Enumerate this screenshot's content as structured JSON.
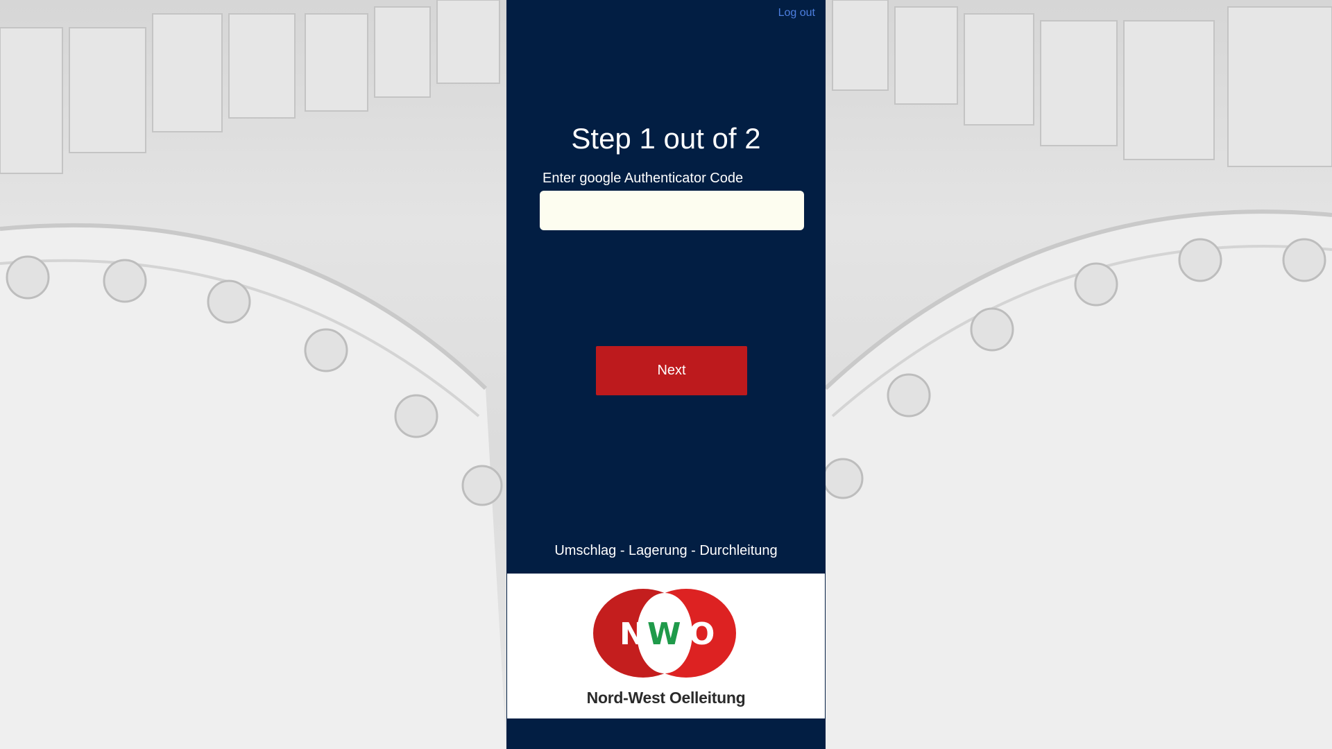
{
  "header": {
    "logout_label": "Log out"
  },
  "step": {
    "title": "Step 1 out of 2"
  },
  "form": {
    "code_label": "Enter google Authenticator Code",
    "code_value": "",
    "code_placeholder": "",
    "next_label": "Next"
  },
  "footer": {
    "tagline": "Umschlag - Lagerung - Durchleitung"
  },
  "logo": {
    "letters": [
      "N",
      "W",
      "O"
    ],
    "caption": "Nord-West Oelleitung"
  },
  "colors": {
    "panel": "#021e43",
    "button": "#bd1a1d",
    "logo_red": "#cc1f1f",
    "logo_green": "#1f9a4a",
    "link": "#4d7fe0",
    "input_bg": "#fdfdf0"
  }
}
